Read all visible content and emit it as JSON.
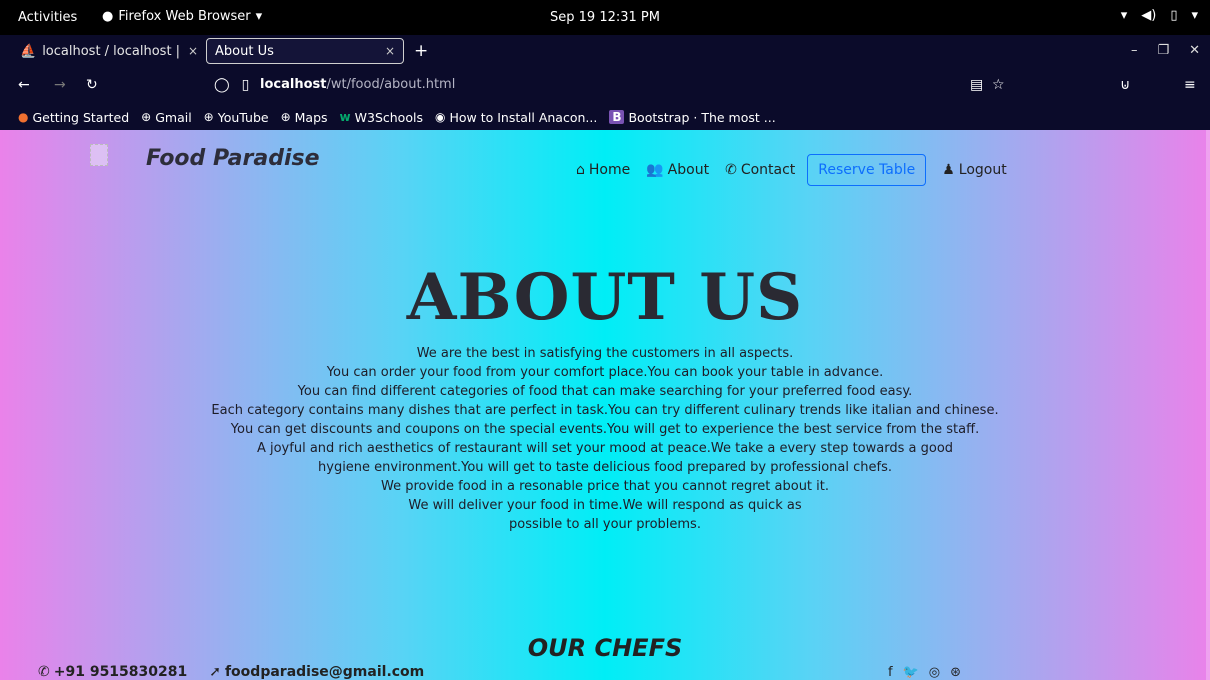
{
  "system": {
    "activities": "Activities",
    "app_menu": "Firefox Web Browser",
    "clock": "Sep 19  12:31 PM"
  },
  "tabs": [
    {
      "label": "localhost / localhost | php"
    },
    {
      "label": "About Us"
    }
  ],
  "address": {
    "host": "localhost",
    "path": "/wt/food/about.html"
  },
  "bookmarks": [
    {
      "label": "Getting Started"
    },
    {
      "label": "Gmail"
    },
    {
      "label": "YouTube"
    },
    {
      "label": "Maps"
    },
    {
      "label": "W3Schools"
    },
    {
      "label": "How to Install Anacon..."
    },
    {
      "label": "Bootstrap · The most ..."
    }
  ],
  "site": {
    "brand": "Food Paradise",
    "nav": {
      "home": "Home",
      "about": "About",
      "contact": "Contact",
      "reserve": "Reserve Table",
      "logout": "Logout"
    },
    "heading": "ABOUT US",
    "paragraph_lines": [
      "We are the best in satisfying the customers in all aspects.",
      "You can order your food from your comfort place.You can book your table in advance.",
      "You can find different categories of food that can make searching for your preferred food easy.",
      "Each category contains many dishes that are perfect in task.You can try different culinary trends like italian and chinese.",
      "You can get discounts and coupons on the special events.You will get to experience the best service from the staff.",
      "A joyful and rich aesthetics of restaurant will set your mood at peace.We take a every step towards a good",
      "hygiene environment.You will get to taste delicious food prepared by professional chefs.",
      "We provide food in a resonable price that you cannot regret about it.",
      "We will deliver your food in time.We will respond as quick as",
      "possible to all your problems."
    ],
    "chefs_heading": "OUR CHEFS",
    "footer": {
      "phone": "+91 9515830281",
      "email": "foodparadise@gmail.com"
    }
  },
  "colors": {
    "gradient_edge": "#ea82ea",
    "gradient_center": "#00eef6",
    "reserve_button": "#0d6efd"
  }
}
